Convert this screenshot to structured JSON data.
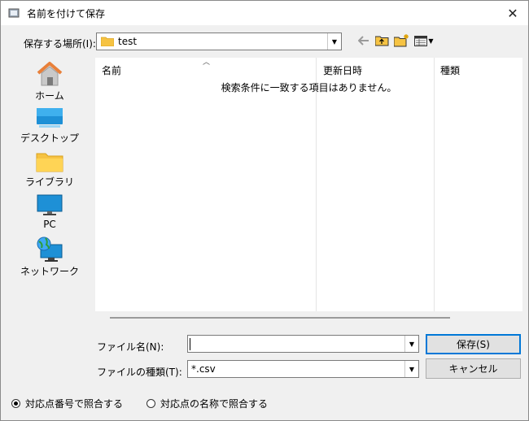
{
  "window": {
    "title": "名前を付けて保存"
  },
  "location": {
    "label": "保存する場所(I):",
    "value": "test"
  },
  "places": [
    {
      "label": "ホーム",
      "icon": "home-icon"
    },
    {
      "label": "デスクトップ",
      "icon": "desktop-icon"
    },
    {
      "label": "ライブラリ",
      "icon": "library-folder-icon"
    },
    {
      "label": "PC",
      "icon": "pc-monitor-icon"
    },
    {
      "label": "ネットワーク",
      "icon": "network-globe-icon"
    }
  ],
  "file_list": {
    "columns": [
      "名前",
      "更新日時",
      "種類"
    ],
    "empty_message": "検索条件に一致する項目はありません。"
  },
  "filename": {
    "label": "ファイル名(N):",
    "value": ""
  },
  "filetype": {
    "label": "ファイルの種類(T):",
    "value": "*.csv"
  },
  "buttons": {
    "save": "保存(S)",
    "cancel": "キャンセル"
  },
  "radios": [
    {
      "label": "対応点番号で照合する",
      "checked": true
    },
    {
      "label": "対応点の名称で照合する",
      "checked": false
    }
  ],
  "colors": {
    "accent": "#0078d7",
    "folder": "#f6c343",
    "icon_blue": "#1e90d6"
  }
}
